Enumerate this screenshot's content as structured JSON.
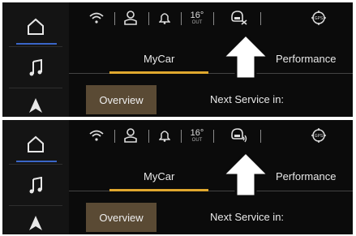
{
  "panels": [
    {
      "id": "top",
      "status": {
        "temp_value": "16°",
        "temp_unit": "OUT",
        "voice_icon": "voice-muted-icon"
      },
      "tabs": {
        "mycar": "MyCar",
        "performance": "Performance"
      },
      "buttons": {
        "overview": "Overview"
      },
      "labels": {
        "next_service": "Next Service in:"
      }
    },
    {
      "id": "bottom",
      "status": {
        "temp_value": "16°",
        "temp_unit": "OUT",
        "voice_icon": "voice-on-icon"
      },
      "tabs": {
        "mycar": "MyCar",
        "performance": "Performance"
      },
      "buttons": {
        "overview": "Overview"
      },
      "labels": {
        "next_service": "Next Service in:"
      }
    }
  ],
  "status_icons": [
    "wifi-icon",
    "driver-profile-icon",
    "notification-bell-icon",
    "temperature",
    "voice-command-icon",
    "gps-icon"
  ],
  "sidebar_icons": [
    "home-icon",
    "music-note-icon",
    "navigation-arrow-icon"
  ],
  "colors": {
    "accent_underline": "#e0a82e",
    "home_indicator": "#3a66c8",
    "overview_bg": "#5a4a34"
  }
}
